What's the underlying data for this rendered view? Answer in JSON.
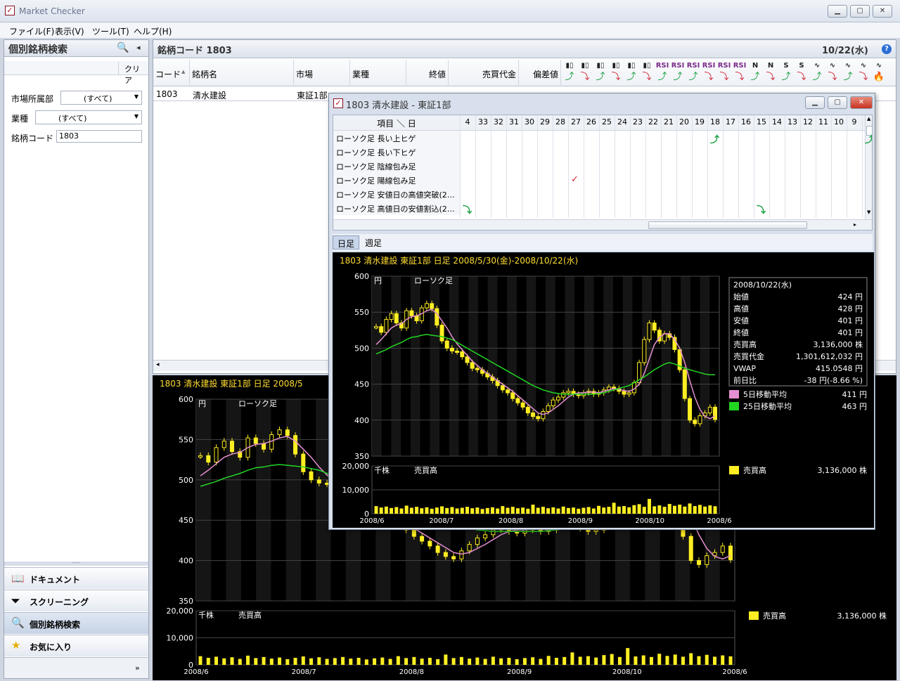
{
  "app": {
    "title": "Market Checker"
  },
  "menu": [
    "ファイル(F)",
    "表示(V)",
    "ツール(T)",
    "ヘルプ(H)"
  ],
  "left": {
    "title": "個別銘柄検索",
    "clear": "クリア",
    "market_label": "市場所属部",
    "market_value": "(すべて)",
    "industry_label": "業種",
    "industry_value": "(すべて)",
    "code_label": "銘柄コード",
    "code_value": "1803",
    "nav": [
      {
        "label": "ドキュメント",
        "icon": "book-icon"
      },
      {
        "label": "スクリーニング",
        "icon": "funnel-icon"
      },
      {
        "label": "個別銘柄検索",
        "icon": "magnifier-icon"
      },
      {
        "label": "お気に入り",
        "icon": "star-icon"
      }
    ]
  },
  "main": {
    "title": "銘柄コード 1803",
    "date": "10/22(水)",
    "columns": [
      "コード",
      "銘柄名",
      "市場",
      "業種",
      "終値",
      "売買代金",
      "偏差値"
    ],
    "row": [
      "1803",
      "清水建設",
      "東証1部"
    ],
    "signals": [
      "candle-up-icon",
      "candle-down-icon",
      "candle-up-icon",
      "candle-down-icon",
      "candle-up-icon",
      "candle-down-icon",
      "rsi-up-icon",
      "rsi-up-icon",
      "rsi-up-icon",
      "rsi-down-icon",
      "rsi-down-icon",
      "rsi-down-icon",
      "n-up-icon",
      "n-down-icon",
      "s-up-icon",
      "s-down-icon",
      "wave-up-icon",
      "wave-down-icon",
      "wave-up-icon",
      "wave-down-icon",
      "fire-icon"
    ]
  },
  "popup": {
    "title": "1803 清水建設 - 東証1部",
    "corner_label": "項目 ＼ 日",
    "days": [
      "4",
      "33",
      "32",
      "31",
      "30",
      "29",
      "28",
      "27",
      "26",
      "25",
      "24",
      "23",
      "22",
      "21",
      "20",
      "19",
      "18",
      "17",
      "16",
      "15",
      "14",
      "13",
      "12",
      "11",
      "10",
      "9",
      "1"
    ],
    "patterns": [
      "ローソク足 長い上ヒゲ",
      "ローソク足 長い下ヒゲ",
      "ローソク足 陰線包み足",
      "ローソク足 陽線包み足",
      "ローソク足 安値日の高値突破(2…",
      "ローソク足 高値日の安値割込(2…"
    ],
    "tabs": [
      "日足",
      "週足"
    ]
  },
  "chart": {
    "header": "1803 清水建設 東証1部 日足 2008/5/30(金)-2008/10/22(水)",
    "header_short": "1803 清水建設 東証1部 日足 2008/5",
    "unit": "円",
    "label": "ローソク足",
    "vol_unit": "千株",
    "vol_label": "売買高",
    "info": [
      [
        "2008/10/22(水)",
        ""
      ],
      [
        "始値",
        "424 円"
      ],
      [
        "高値",
        "428 円"
      ],
      [
        "安値",
        "401 円"
      ],
      [
        "終値",
        "401 円"
      ],
      [
        "売買高",
        "3,136,000 株"
      ],
      [
        "売買代金",
        "1,301,612,032 円"
      ],
      [
        "VWAP",
        "415.0548 円"
      ],
      [
        "前日比",
        "-38 円(-8.66 %)"
      ]
    ],
    "legend": [
      {
        "name": "5日移動平均",
        "value": "411 円",
        "color": "#e58fd2"
      },
      {
        "name": "25日移動平均",
        "value": "463 円",
        "color": "#22d622"
      }
    ],
    "vol_legend": {
      "name": "売買高",
      "value": "3,136,000 株",
      "color": "#ffee22"
    }
  },
  "chart_data": {
    "type": "bar",
    "title": "1803 清水建設 東証1部 日足 2008/5/30(金)-2008/10/22(水)",
    "x_ticks": [
      "2008/6",
      "2008/7",
      "2008/8",
      "2008/9",
      "2008/10",
      "2008/6"
    ],
    "price_ylim": [
      350,
      600
    ],
    "price_yticks": [
      350,
      400,
      450,
      500,
      550,
      600
    ],
    "volume_ylim": [
      0,
      20000
    ],
    "volume_yticks": [
      "0",
      "10,000",
      "20,000"
    ],
    "close": [
      530,
      522,
      540,
      548,
      535,
      528,
      552,
      545,
      538,
      556,
      562,
      555,
      532,
      510,
      500,
      496,
      495,
      488,
      480,
      472,
      470,
      465,
      460,
      455,
      448,
      442,
      438,
      430,
      424,
      418,
      410,
      405,
      402,
      412,
      420,
      428,
      432,
      438,
      440,
      436,
      434,
      438,
      440,
      436,
      438,
      442,
      446,
      444,
      440,
      436,
      438,
      452,
      480,
      512,
      535,
      525,
      510,
      520,
      515,
      498,
      470,
      430,
      400,
      395,
      406,
      410,
      418,
      401
    ],
    "ma5": [
      505,
      512,
      520,
      528,
      532,
      534,
      540,
      544,
      545,
      548,
      552,
      554,
      548,
      538,
      528,
      516,
      506,
      498,
      490,
      482,
      476,
      470,
      465,
      460,
      455,
      450,
      445,
      440,
      434,
      428,
      422,
      416,
      410,
      408,
      410,
      415,
      420,
      426,
      432,
      436,
      438,
      438,
      439,
      439,
      438,
      440,
      442,
      444,
      443,
      441,
      440,
      443,
      450,
      465,
      485,
      505,
      515,
      520,
      520,
      512,
      500,
      480,
      455,
      432,
      415,
      405,
      402,
      406
    ],
    "ma25": [
      492,
      495,
      498,
      502,
      505,
      508,
      512,
      515,
      516,
      518,
      519,
      518,
      517,
      516,
      514,
      512,
      508,
      504,
      500,
      496,
      492,
      488,
      484,
      480,
      476,
      472,
      468,
      464,
      460,
      456,
      452,
      448,
      445,
      442,
      440,
      438,
      437,
      436,
      436,
      436,
      436,
      436,
      436,
      436,
      437,
      438,
      440,
      442,
      444,
      446,
      448,
      452,
      456,
      460,
      465,
      470,
      474,
      478,
      480,
      478,
      475,
      472,
      470,
      468,
      466,
      464,
      463,
      463
    ],
    "volume": [
      3200,
      2600,
      3000,
      2400,
      2800,
      2200,
      3400,
      2500,
      2900,
      2300,
      2700,
      2100,
      2600,
      3100,
      2400,
      2800,
      2200,
      2500,
      2900,
      2300,
      2600,
      2000,
      2400,
      2700,
      2200,
      3200,
      2500,
      2900,
      2300,
      2600,
      2100,
      3800,
      2500,
      2900,
      2300,
      2700,
      2200,
      3000,
      2400,
      2600,
      2100,
      2500,
      2800,
      2200,
      3300,
      2600,
      2900,
      4600,
      3000,
      3200,
      2700,
      3600,
      4000,
      2900,
      6200,
      3100,
      3500,
      2900,
      4100,
      3300,
      3800,
      3000,
      4300,
      3200,
      3700,
      3000,
      3500,
      3136
    ]
  }
}
